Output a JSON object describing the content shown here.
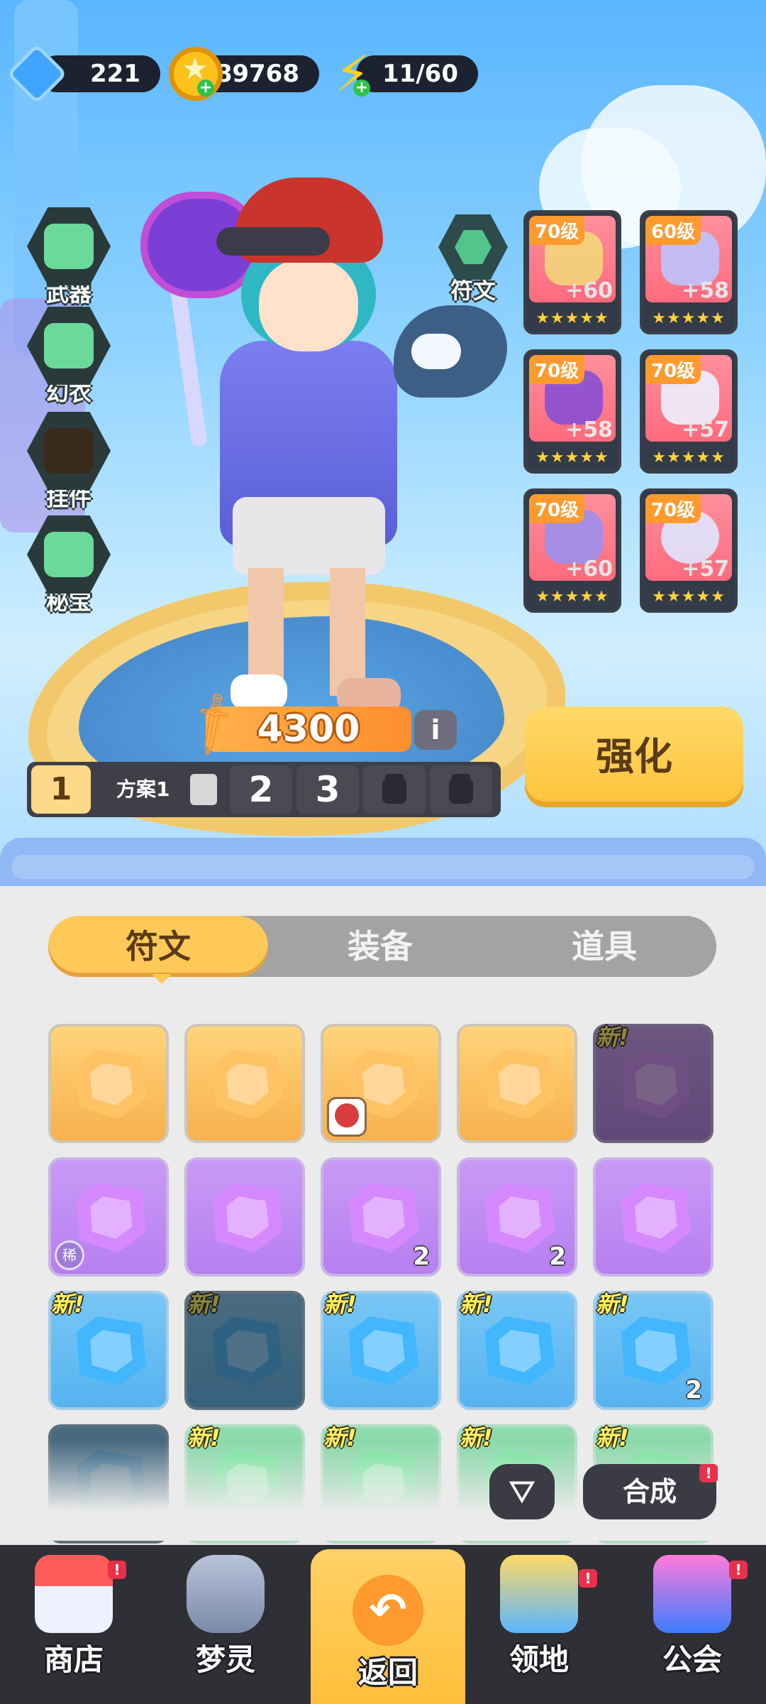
{
  "currency": {
    "gems": "221",
    "coins": "89768",
    "stamina": "11/60"
  },
  "left_nav": [
    {
      "label": "武器",
      "icon": "hammer-icon"
    },
    {
      "label": "幻衣",
      "icon": "shirt-icon"
    },
    {
      "label": "挂件",
      "icon": "pendant-icon"
    },
    {
      "label": "秘宝",
      "icon": "treasure-icon"
    }
  ],
  "rune_button": {
    "label": "符文",
    "icon": "rune-hex-icon"
  },
  "equipment": [
    {
      "level": "70级",
      "plus": "+60",
      "item": "helmet"
    },
    {
      "level": "60级",
      "plus": "+58",
      "item": "jacket"
    },
    {
      "level": "70级",
      "plus": "+58",
      "item": "bracer"
    },
    {
      "level": "70级",
      "plus": "+57",
      "item": "shorts"
    },
    {
      "level": "70级",
      "plus": "+60",
      "item": "shoes"
    },
    {
      "level": "70级",
      "plus": "+57",
      "item": "orb"
    }
  ],
  "power": {
    "value": "4300",
    "icon": "sword-icon",
    "info_label": "i"
  },
  "plans": {
    "active_number": "1",
    "active_name": "方案1",
    "slots": [
      "2",
      "3"
    ],
    "locked_count": 2
  },
  "enhance_label": "强化",
  "tabs": [
    "符文",
    "装备",
    "道具"
  ],
  "active_tab": 0,
  "inventory": [
    {
      "color": "orange",
      "count": "",
      "new": false,
      "dark": false,
      "badge": ""
    },
    {
      "color": "orange",
      "count": "",
      "new": false,
      "dark": false,
      "badge": ""
    },
    {
      "color": "orange",
      "count": "",
      "new": false,
      "dark": false,
      "badge": "avatar"
    },
    {
      "color": "orange",
      "count": "",
      "new": false,
      "dark": false,
      "badge": ""
    },
    {
      "color": "purple",
      "count": "",
      "new": true,
      "dark": true,
      "badge": ""
    },
    {
      "color": "purple",
      "count": "",
      "new": false,
      "dark": false,
      "badge": "稀"
    },
    {
      "color": "purple",
      "count": "",
      "new": false,
      "dark": false,
      "badge": ""
    },
    {
      "color": "purple",
      "count": "2",
      "new": false,
      "dark": false,
      "badge": ""
    },
    {
      "color": "purple",
      "count": "2",
      "new": false,
      "dark": false,
      "badge": ""
    },
    {
      "color": "purple",
      "count": "",
      "new": false,
      "dark": false,
      "badge": ""
    },
    {
      "color": "blue",
      "count": "",
      "new": true,
      "dark": false,
      "badge": ""
    },
    {
      "color": "blue",
      "count": "",
      "new": true,
      "dark": true,
      "badge": ""
    },
    {
      "color": "blue",
      "count": "",
      "new": true,
      "dark": false,
      "badge": ""
    },
    {
      "color": "blue",
      "count": "",
      "new": true,
      "dark": false,
      "badge": ""
    },
    {
      "color": "blue",
      "count": "2",
      "new": true,
      "dark": false,
      "badge": ""
    },
    {
      "color": "blue",
      "count": "",
      "new": false,
      "dark": true,
      "badge": ""
    },
    {
      "color": "green",
      "count": "",
      "new": true,
      "dark": false,
      "badge": ""
    },
    {
      "color": "green",
      "count": "",
      "new": true,
      "dark": false,
      "badge": ""
    },
    {
      "color": "green",
      "count": "",
      "new": true,
      "dark": false,
      "badge": ""
    },
    {
      "color": "green",
      "count": "",
      "new": true,
      "dark": false,
      "badge": ""
    }
  ],
  "new_label": "新!",
  "filter_icon": "filter-icon",
  "combine_label": "合成",
  "alert_mark": "!",
  "bottom_nav": [
    {
      "label": "商店",
      "icon": "shop-icon",
      "alert": true
    },
    {
      "label": "梦灵",
      "icon": "robot-icon",
      "alert": false
    },
    {
      "label": "返回",
      "icon": "return-icon",
      "alert": false,
      "active": true
    },
    {
      "label": "领地",
      "icon": "territory-icon",
      "alert": true
    },
    {
      "label": "公会",
      "icon": "guild-icon",
      "alert": true
    }
  ],
  "colors": {
    "accent_yellow": "#ffc95a",
    "dark_pill": "#1d2230",
    "panel_bg": "#ebebeb",
    "alert_red": "#e8304a"
  }
}
